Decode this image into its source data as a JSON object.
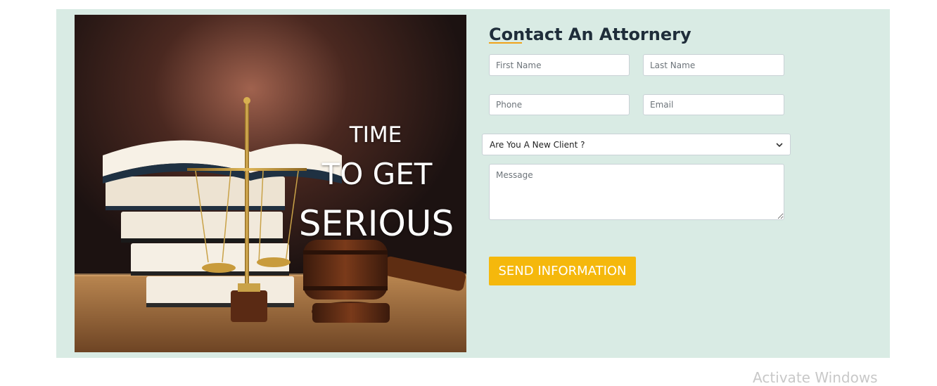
{
  "hero": {
    "line1": "TIME",
    "line2": "TO GET",
    "line3": "SERIOUS"
  },
  "form": {
    "title": "Contact An Attornery",
    "first_name_placeholder": "First Name",
    "last_name_placeholder": "Last Name",
    "phone_placeholder": "Phone",
    "email_placeholder": "Email",
    "client_select_value": "Are You A New Client ?",
    "message_placeholder": "Message",
    "submit_label": "SEND INFORMATION"
  },
  "watermark": "Activate Windows",
  "colors": {
    "section_background": "#d9ebe4",
    "accent": "#f5b80c",
    "title_underline": "#f0a31b",
    "title_text": "#1f2d3a"
  },
  "icons": {
    "select_arrow": "chevron-down-icon"
  }
}
